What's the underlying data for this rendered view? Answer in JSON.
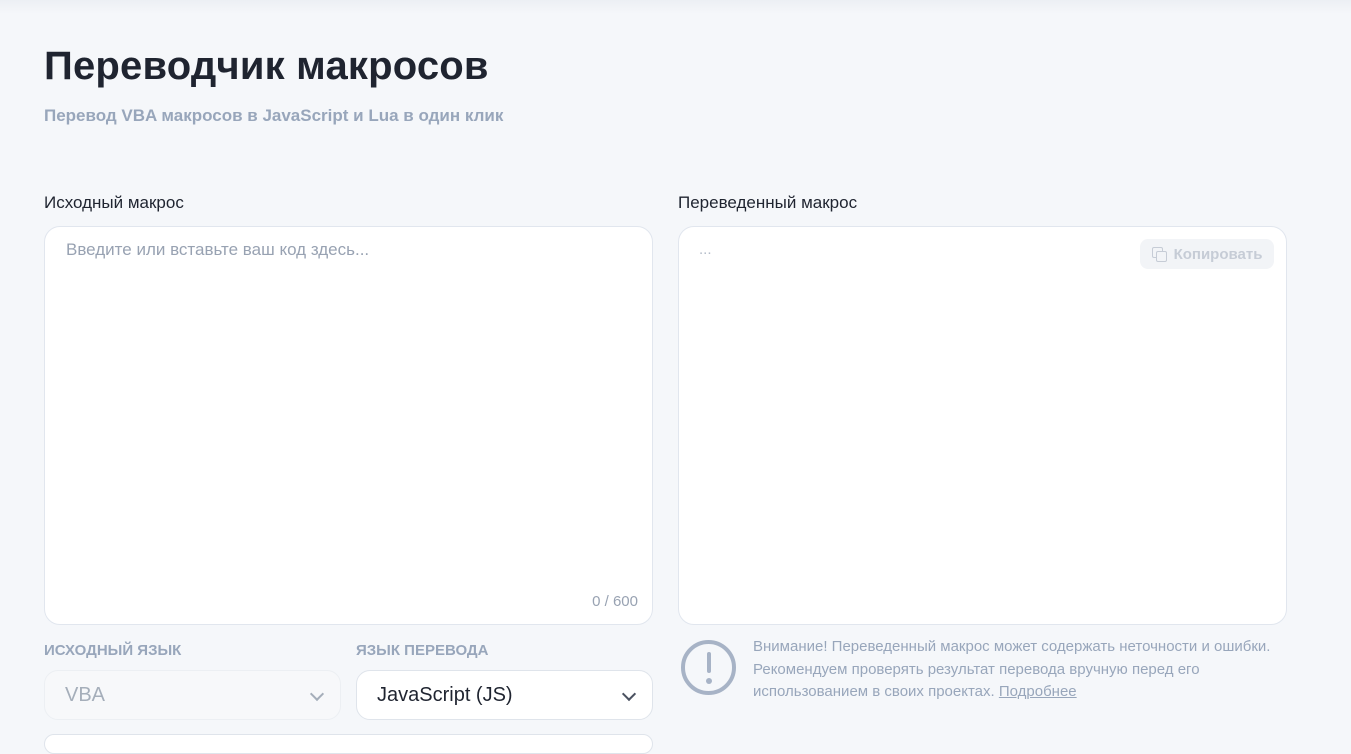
{
  "header": {
    "title": "Переводчик макросов",
    "subtitle": "Перевод VBA макросов в JavaScript и Lua в один клик"
  },
  "source": {
    "label": "Исходный макрос",
    "placeholder": "Введите или вставьте ваш код здесь...",
    "counter": "0 / 600"
  },
  "result": {
    "label": "Переведенный макрос",
    "placeholder": "...",
    "copy_label": "Копировать",
    "copy_icon": "copy-icon"
  },
  "source_lang": {
    "label": "ИСХОДНЫЙ ЯЗЫК",
    "value": "VBA"
  },
  "target_lang": {
    "label": "ЯЗЫК ПЕРЕВОДА",
    "value": "JavaScript (JS)"
  },
  "warning": {
    "icon": "exclamation-circle-icon",
    "text": "Внимание! Переведенный макрос может содержать неточности и ошибки. Рекомендуем проверять результат перевода вручную перед его использованием в своих проектах.",
    "link": "Подробнее"
  },
  "colors": {
    "background": "#f5f7fa",
    "muted": "#98a6bb",
    "text": "#1f2430"
  }
}
